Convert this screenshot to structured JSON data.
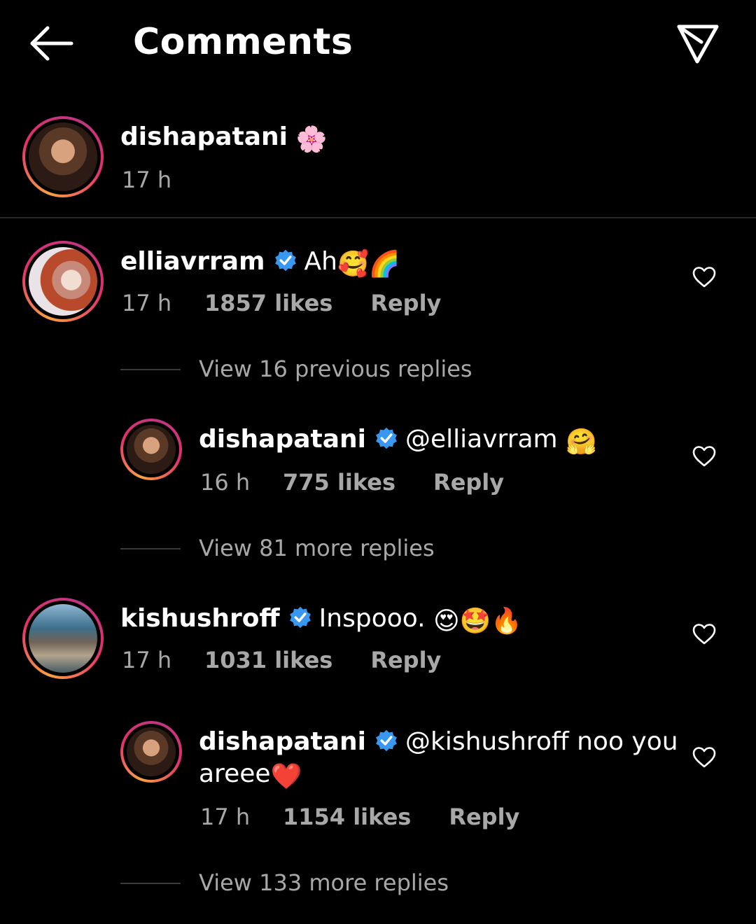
{
  "header": {
    "title": "Comments",
    "back_icon": "arrow-left-icon",
    "share_icon": "paper-plane-icon"
  },
  "caption": {
    "username": "dishapatani",
    "emoji": "🌸",
    "time": "17 h"
  },
  "comments": [
    {
      "username": "elliavrram",
      "verified": true,
      "text": "Ah",
      "emoji": "🥰🌈",
      "time": "17 h",
      "likes": "1857 likes",
      "reply": "Reply",
      "view_replies": "View 16 previous replies",
      "replies": [
        {
          "username": "dishapatani",
          "verified": true,
          "mention": "@elliavrram",
          "text": "",
          "emoji": "🤗",
          "time": "16 h",
          "likes": "775 likes",
          "reply": "Reply"
        }
      ],
      "view_more": "View 81 more replies"
    },
    {
      "username": "kishushroff",
      "verified": true,
      "text": "Inspooo.",
      "emoji": "😍🤩🔥",
      "time": "17 h",
      "likes": "1031 likes",
      "reply": "Reply",
      "replies": [
        {
          "username": "dishapatani",
          "verified": true,
          "mention": "@kishushroff",
          "text": "noo you",
          "text_line2": "areee",
          "emoji": "❤️",
          "time": "17 h",
          "likes": "1154 likes",
          "reply": "Reply"
        }
      ],
      "view_more": "View 133 more replies"
    }
  ],
  "colors": {
    "background": "#000000",
    "secondary_text": "#a8a8a8",
    "verified_blue": "#3897f0",
    "divider": "#262626"
  }
}
